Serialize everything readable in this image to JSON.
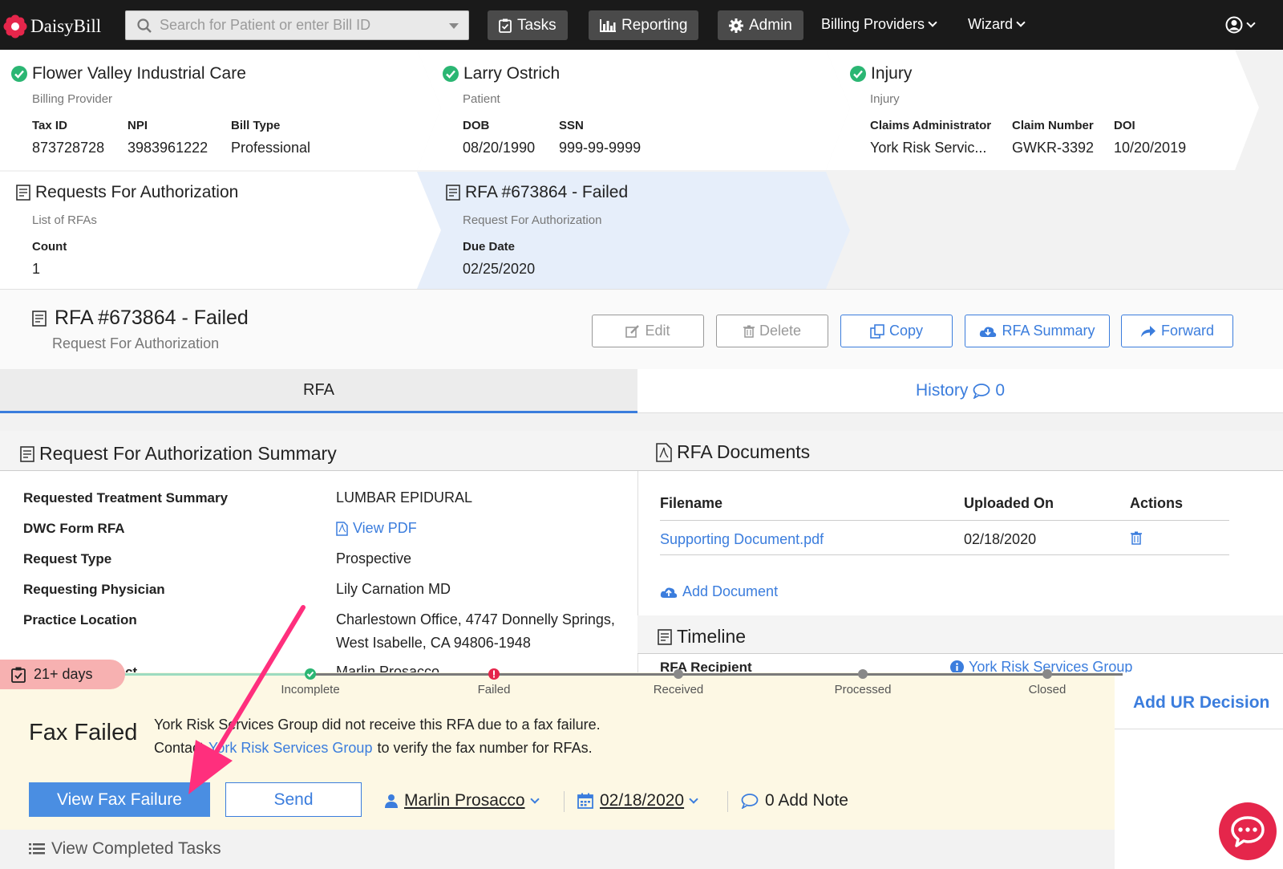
{
  "nav": {
    "logo_text": "DaisyBill",
    "search_placeholder": "Search for Patient or enter Bill ID",
    "tasks_label": "Tasks",
    "reporting_label": "Reporting",
    "admin_label": "Admin",
    "billing_providers_label": "Billing Providers",
    "wizard_label": "Wizard"
  },
  "breadcrumbs": {
    "provider": {
      "title": "Flower Valley Industrial Care",
      "subtitle": "Billing Provider",
      "fields": [
        {
          "label": "Tax ID",
          "value": "873728728"
        },
        {
          "label": "NPI",
          "value": "3983961222"
        },
        {
          "label": "Bill Type",
          "value": "Professional"
        }
      ]
    },
    "patient": {
      "title": "Larry Ostrich",
      "subtitle": "Patient",
      "fields": [
        {
          "label": "DOB",
          "value": "08/20/1990"
        },
        {
          "label": "SSN",
          "value": "999-99-9999"
        }
      ]
    },
    "injury": {
      "title": "Injury",
      "subtitle": "Injury",
      "fields": [
        {
          "label": "Claims Administrator",
          "value": "York Risk Servic..."
        },
        {
          "label": "Claim Number",
          "value": "GWKR-3392"
        },
        {
          "label": "DOI",
          "value": "10/20/2019"
        }
      ]
    },
    "rfas": {
      "title": "Requests For Authorization",
      "subtitle": "List of RFAs",
      "fields": [
        {
          "label": "Count",
          "value": "1"
        }
      ]
    },
    "rfa": {
      "title": "RFA #673864 - Failed",
      "subtitle": "Request For Authorization",
      "fields": [
        {
          "label": "Due Date",
          "value": "02/25/2020"
        }
      ]
    }
  },
  "header": {
    "title": "RFA #673864 - Failed",
    "subtitle": "Request For Authorization",
    "edit_label": "Edit",
    "delete_label": "Delete",
    "copy_label": "Copy",
    "summary_label": "RFA Summary",
    "forward_label": "Forward"
  },
  "tabs": {
    "rfa_label": "RFA",
    "history_label": "History",
    "history_count": "0"
  },
  "summary": {
    "heading": "Request For Authorization Summary",
    "rows": [
      {
        "label": "Requested Treatment Summary",
        "value": "LUMBAR EPIDURAL"
      },
      {
        "label": "DWC Form RFA",
        "value": "View PDF"
      },
      {
        "label": "Request Type",
        "value": "Prospective"
      },
      {
        "label": "Requesting Physician",
        "value": "Lily Carnation MD"
      },
      {
        "label": "Practice Location",
        "value": "Charlestown Office, 4747 Donnelly Springs,",
        "value2": "West Isabelle, CA 94806-1948"
      }
    ],
    "partial_label": "ct",
    "partial_value": "Marlin Prosacco"
  },
  "documents": {
    "heading": "RFA Documents",
    "columns": [
      "Filename",
      "Uploaded On",
      "Actions"
    ],
    "rows": [
      {
        "filename": "Supporting Document.pdf",
        "uploaded_on": "02/18/2020"
      }
    ],
    "add_label": "Add Document"
  },
  "timeline": {
    "heading": "Timeline",
    "recipient_label": "RFA Recipient",
    "recipient_value": "York Risk Services Group"
  },
  "task": {
    "days_label": "21+ days",
    "stages": [
      "Incomplete",
      "Failed",
      "Received",
      "Processed",
      "Closed"
    ],
    "heading": "Fax Failed",
    "line1": "York Risk Services Group did not receive this RFA due to a fax failure.",
    "line2_prefix": "Contact",
    "line2_link": "York Risk Services Group",
    "line2_suffix": "to verify the fax number for RFAs.",
    "view_fax_label": "View Fax Failure",
    "send_label": "Send",
    "assignee": "Marlin Prosacco",
    "date": "02/18/2020",
    "note_label": "0 Add Note",
    "add_ur_label": "Add UR Decision",
    "completed_label": "View Completed Tasks"
  },
  "colors": {
    "accent": "#3b7ddd",
    "failed": "#e5264b",
    "success": "#2bb673",
    "arrow": "#ff2f7d"
  }
}
